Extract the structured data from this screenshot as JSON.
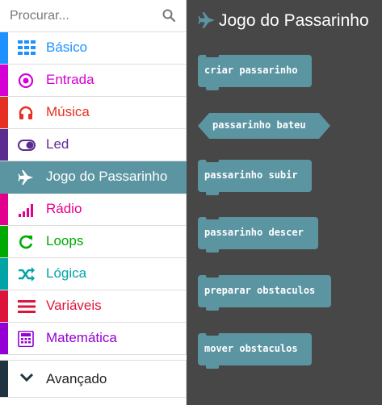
{
  "search": {
    "placeholder": "Procurar..."
  },
  "categories": [
    {
      "label": "Básico",
      "color": "#1e90ff",
      "icon": "grid-icon"
    },
    {
      "label": "Entrada",
      "color": "#d400d4",
      "icon": "target-icon"
    },
    {
      "label": "Música",
      "color": "#e63022",
      "icon": "headphones-icon"
    },
    {
      "label": "Led",
      "color": "#5c2d91",
      "icon": "toggle-icon"
    },
    {
      "label": "Jogo do Passarinho",
      "color": "#5b95a2",
      "icon": "airplane-icon"
    },
    {
      "label": "Rádio",
      "color": "#e3008c",
      "icon": "signal-icon"
    },
    {
      "label": "Loops",
      "color": "#00aa00",
      "icon": "refresh-icon"
    },
    {
      "label": "Lógica",
      "color": "#00a4a6",
      "icon": "shuffle-icon"
    },
    {
      "label": "Variáveis",
      "color": "#dc143c",
      "icon": "list-icon"
    },
    {
      "label": "Matemática",
      "color": "#9400d3",
      "icon": "calculator-icon"
    }
  ],
  "advanced": {
    "label": "Avançado",
    "color": "#1f3340"
  },
  "flyout": {
    "title": "Jogo do Passarinho",
    "background": "#474747",
    "block_color": "#5b95a2",
    "blocks": [
      "criar passarinho",
      "passarinho bateu",
      "passarinho subir",
      "passarinho descer",
      "preparar obstaculos",
      "mover obstaculos"
    ]
  }
}
